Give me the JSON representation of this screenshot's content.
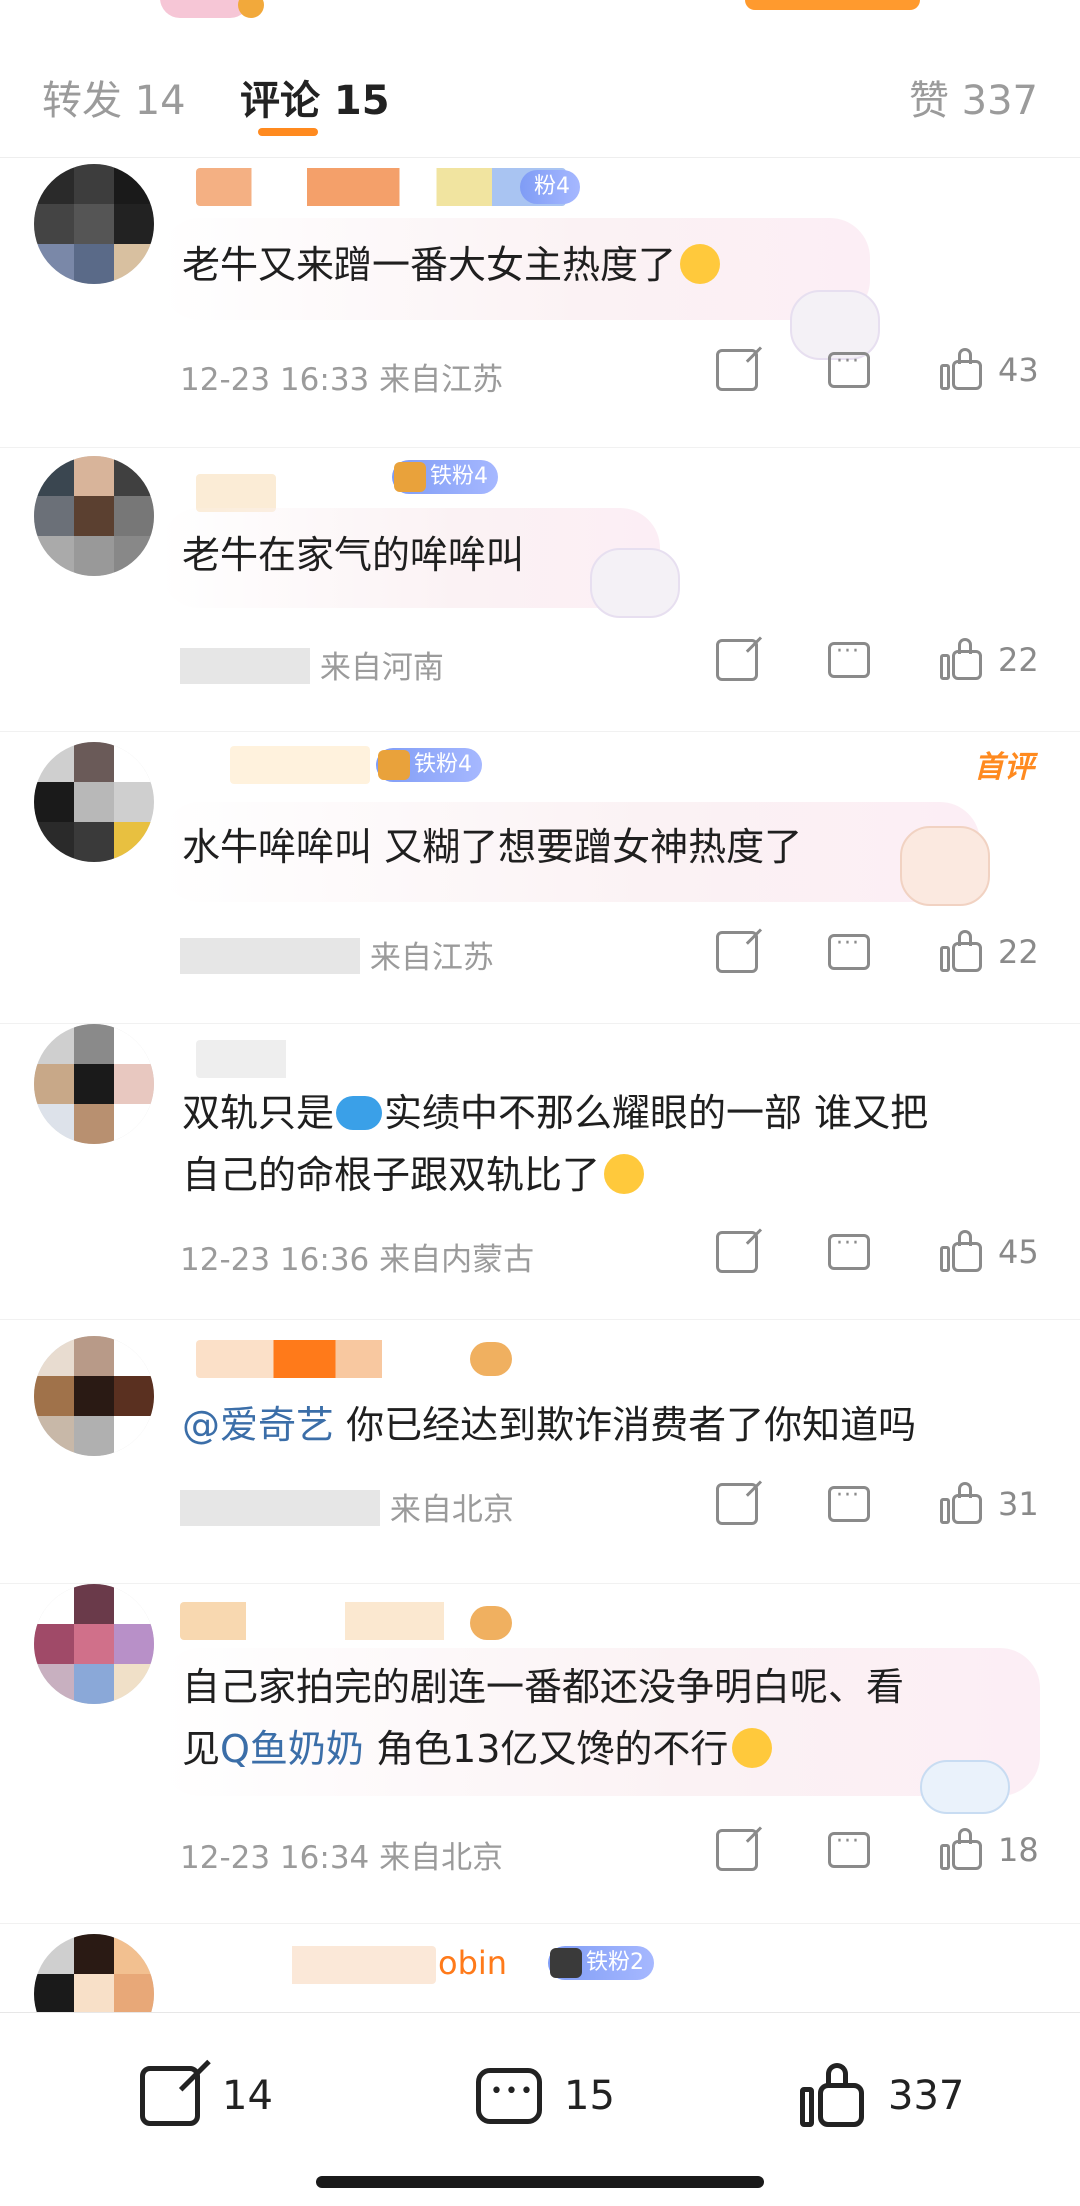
{
  "tabs": {
    "repost_label": "转发 14",
    "comment_label": "评论 15",
    "like_label": "赞 337"
  },
  "comments": [
    {
      "badge": "粉4",
      "text": "老牛又来蹭一番大女主热度了",
      "meta": "12-23 16:33 来自江苏",
      "likes": "43"
    },
    {
      "badge": "铁粉4",
      "text": "老牛在家气的哞哞叫",
      "meta": "来自河南",
      "likes": "22"
    },
    {
      "badge": "铁粉4",
      "top_label": "首评",
      "text": "水牛哞哞叫 又糊了想要蹭女神热度了",
      "meta": "来自江苏",
      "likes": "22"
    },
    {
      "text_part1": "双轨只是",
      "text_part2": "实绩中不那么耀眼的一部 谁又把",
      "text_line2": "自己的命根子跟双轨比了",
      "meta": "12-23 16:36 来自内蒙古",
      "likes": "45"
    },
    {
      "mention": "@爱奇艺",
      "text": " 你已经达到欺诈消费者了你知道吗",
      "meta": "来自北京",
      "likes": "31"
    },
    {
      "text_line1": "自己家拍完的剧连一番都还没争明白呢、看",
      "text_line2_prefix": "见",
      "topic": "Q鱼奶奶",
      "text_line2_suffix": " 角色13亿又馋的不行",
      "meta": "12-23 16:34 来自北京",
      "likes": "18"
    },
    {
      "name_fragment": "obin",
      "badge": "铁粉2"
    }
  ],
  "bottom_bar": {
    "repost_count": "14",
    "comment_count": "15",
    "like_count": "337"
  }
}
